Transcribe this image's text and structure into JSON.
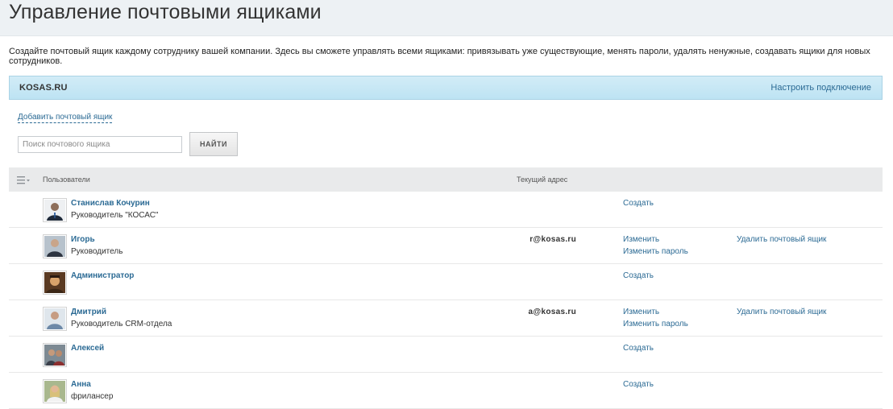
{
  "page": {
    "title": "Управление почтовыми ящиками",
    "description": "Создайте почтовый ящик каждому сотруднику вашей компании. Здесь вы сможете управлять всеми ящиками: привязывать уже существующие, менять пароли, удалять ненужные, создавать ящики для новых сотрудников."
  },
  "domain": {
    "name": "KOSAS.RU",
    "config_link": "Настроить подключение"
  },
  "toolbar": {
    "add_mailbox": "Добавить почтовый ящик",
    "search_placeholder": "Поиск почтового ящика",
    "find_button": "НАЙТИ"
  },
  "table": {
    "columns": {
      "users": "Пользователи",
      "address": "Текущий адрес"
    },
    "rows": [
      {
        "name": "Станислав Кочурин",
        "position": "Руководитель \"КОСАС\"",
        "address": "",
        "action1": "Создать",
        "action2": "",
        "delete": ""
      },
      {
        "name": "Игорь",
        "position": "Руководитель",
        "address": "r@kosas.ru",
        "action1": "Изменить",
        "action2": "Изменить пароль",
        "delete": "Удалить почтовый ящик"
      },
      {
        "name": "Администратор",
        "position": "",
        "address": "",
        "action1": "Создать",
        "action2": "",
        "delete": ""
      },
      {
        "name": "Дмитрий",
        "position": "Руководитель CRM-отдела",
        "address": "a@kosas.ru",
        "action1": "Изменить",
        "action2": "Изменить пароль",
        "delete": "Удалить почтовый ящик"
      },
      {
        "name": "Алексей",
        "position": "",
        "address": "",
        "action1": "Создать",
        "action2": "",
        "delete": ""
      },
      {
        "name": "Анна",
        "position": "фрилансер",
        "address": "",
        "action1": "Создать",
        "action2": "",
        "delete": ""
      }
    ]
  },
  "icons": {
    "menu": "list-menu-icon",
    "avatar": "user-photo-icon"
  },
  "colors": {
    "link": "#2b6a94",
    "domain_bar": "#c8e8f5",
    "header_bg": "#e9eaeb"
  }
}
